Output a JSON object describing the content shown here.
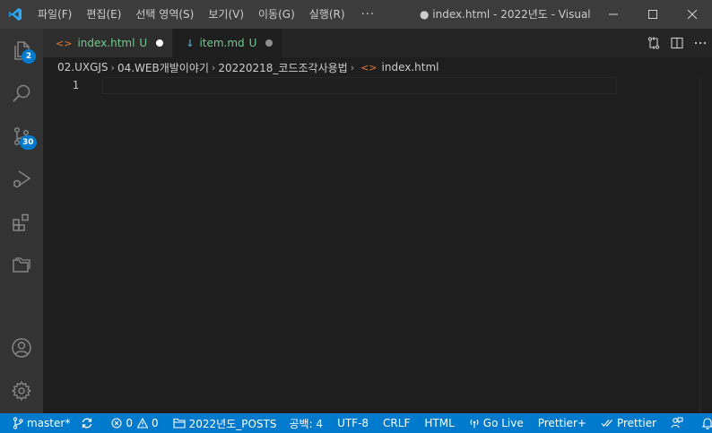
{
  "titlebar": {
    "menu": [
      "파일(F)",
      "편집(E)",
      "선택 영역(S)",
      "보기(V)",
      "이동(G)",
      "실행(R)"
    ],
    "more": "···",
    "window_title": "● index.html - 2022년도 - Visual ..."
  },
  "activity_badges": {
    "explorer": "2",
    "source_control": "30"
  },
  "tabs": [
    {
      "label": "index.html",
      "status": "U",
      "icon": "<>",
      "icon_color": "#e37933",
      "dot_color": "#ffffff",
      "active": false
    },
    {
      "label": "item.md",
      "status": "U",
      "icon": "↓",
      "icon_color": "#519aba",
      "dot_color": "#8d8d8d",
      "active": true
    }
  ],
  "breadcrumb": {
    "items": [
      "02.UXGJS",
      "04.WEB개발이야기",
      "20220218_코드조각사용법",
      "index.html"
    ],
    "file_icon": "<>"
  },
  "editor": {
    "line_numbers": [
      "1"
    ]
  },
  "statusbar": {
    "branch": "master*",
    "errors": "0",
    "warnings": "0",
    "folder": "2022년도_POSTS",
    "indent": "공백: 4",
    "encoding": "UTF-8",
    "eol": "CRLF",
    "language": "HTML",
    "go_live": "Go Live",
    "prettier_plus": "Prettier+",
    "prettier": "Prettier"
  },
  "colors": {
    "accent": "#007acc",
    "modified_green": "#73c991",
    "html_icon": "#e37933"
  }
}
